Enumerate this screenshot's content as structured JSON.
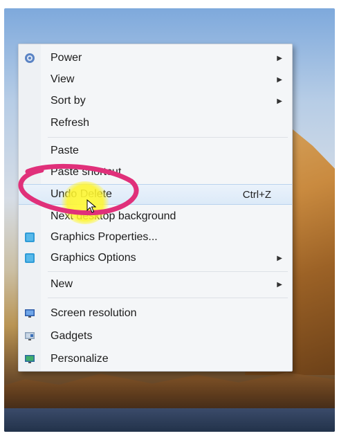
{
  "menu": {
    "items": [
      {
        "label": "Power",
        "has_submenu": true,
        "icon": "power-icon"
      },
      {
        "label": "View",
        "has_submenu": true
      },
      {
        "label": "Sort by",
        "has_submenu": true
      },
      {
        "label": "Refresh",
        "has_submenu": false
      },
      {
        "label": "Paste",
        "has_submenu": false
      },
      {
        "label": "Paste shortcut",
        "has_submenu": false
      },
      {
        "label": "Undo Delete",
        "shortcut": "Ctrl+Z",
        "highlighted": true
      },
      {
        "label": "Next desktop background",
        "has_submenu": false
      },
      {
        "label": "Graphics Properties...",
        "has_submenu": false,
        "icon": "graphics-icon"
      },
      {
        "label": "Graphics Options",
        "has_submenu": true,
        "icon": "graphics-icon"
      },
      {
        "label": "New",
        "has_submenu": true
      },
      {
        "label": "Screen resolution",
        "has_submenu": false,
        "icon": "monitor-icon"
      },
      {
        "label": "Gadgets",
        "has_submenu": false,
        "icon": "gadgets-icon"
      },
      {
        "label": "Personalize",
        "has_submenu": false,
        "icon": "personalize-icon"
      }
    ],
    "submenu_arrow": "▶"
  },
  "colors": {
    "menu_bg": "#f4f6f8",
    "highlight_bg": "#dceaf8",
    "annotation_pink": "#e0307a",
    "annotation_yellow": "#fff53a"
  }
}
